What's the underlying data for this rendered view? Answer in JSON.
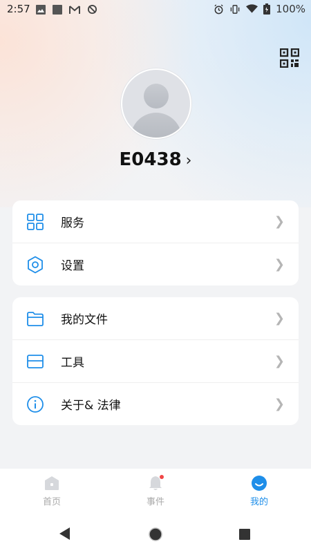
{
  "status_bar": {
    "time": "2:57",
    "battery": "100%"
  },
  "profile": {
    "username": "E0438",
    "chevron": "›"
  },
  "menu_group_1": [
    {
      "label": "服务",
      "icon": "grid-icon"
    },
    {
      "label": "设置",
      "icon": "hexagon-settings-icon"
    }
  ],
  "menu_group_2": [
    {
      "label": "我的文件",
      "icon": "folder-icon"
    },
    {
      "label": "工具",
      "icon": "toolbox-icon"
    },
    {
      "label": "关于& 法律",
      "icon": "info-icon"
    }
  ],
  "bottom_nav": [
    {
      "label": "首页",
      "icon": "home-icon",
      "active": false
    },
    {
      "label": "事件",
      "icon": "bell-icon",
      "active": false
    },
    {
      "label": "我的",
      "icon": "profile-smile-icon",
      "active": true
    }
  ],
  "colors": {
    "accent": "#1e8ee9",
    "inactive": "#aaaaaa",
    "badge": "#f04646"
  }
}
